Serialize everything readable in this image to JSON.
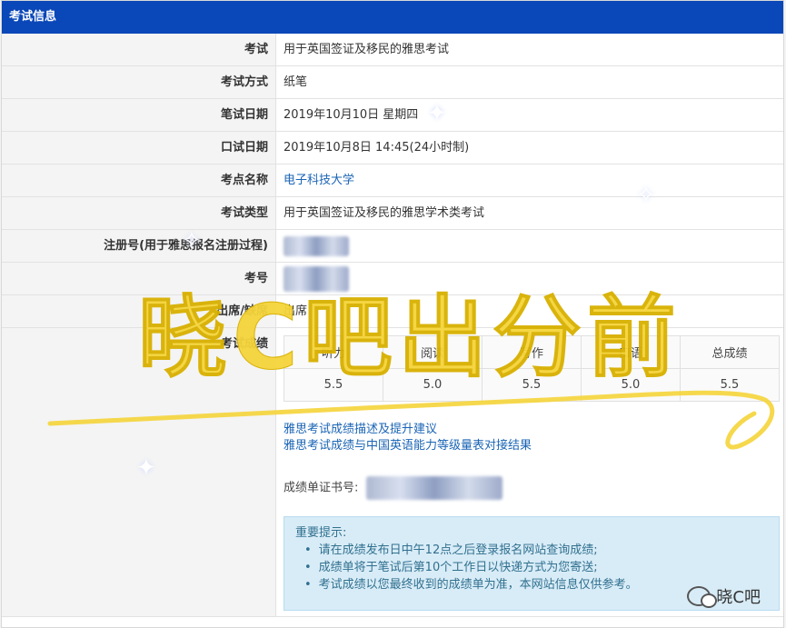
{
  "header": {
    "title": "考试信息"
  },
  "rows": [
    {
      "label": "考试",
      "value": "用于英国签证及移民的雅思考试"
    },
    {
      "label": "考试方式",
      "value": "纸笔"
    },
    {
      "label": "笔试日期",
      "value": "2019年10月10日 星期四"
    },
    {
      "label": "口试日期",
      "value": "2019年10月8日 14:45(24小时制)"
    },
    {
      "label": "考点名称",
      "value": "电子科技大学"
    },
    {
      "label": "考试类型",
      "value": "用于英国签证及移民的雅思学术类考试"
    },
    {
      "label": "注册号(用于雅思报名注册过程)",
      "value": ""
    },
    {
      "label": "考号",
      "value": ""
    },
    {
      "label": "出席/缺席",
      "value": "出席"
    }
  ],
  "scores": {
    "label": "考试成绩",
    "headers": [
      "听力",
      "阅读",
      "写作",
      "口语",
      "总成绩"
    ],
    "values": [
      "5.5",
      "5.0",
      "5.5",
      "5.0",
      "5.5"
    ]
  },
  "links": {
    "score_desc": "雅思考试成绩描述及提升建议",
    "cefr": "雅思考试成绩与中国英语能力等级量表对接结果"
  },
  "certificate": {
    "label": "成绩单证书号:"
  },
  "notice": {
    "title": "重要提示:",
    "items": [
      "请在成绩发布日中午12点之后登录报名网站查询成绩;",
      "成绩单将于笔试后第10个工作日以快递方式为您寄送;",
      "考试成绩以您最终收到的成绩单为准，本网站信息仅供参考。"
    ]
  },
  "overlay": {
    "text": "晓C吧出分前"
  },
  "watermark": {
    "text": "晓C吧"
  },
  "colors": {
    "header_bg": "#0a47b8",
    "link": "#1a64b5",
    "notice_bg": "#d8ecf7",
    "overlay": "#f5d43a"
  }
}
